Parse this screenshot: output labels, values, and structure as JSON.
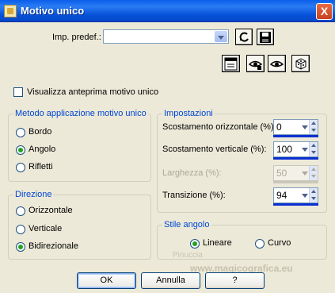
{
  "window": {
    "title": "Motivo unico",
    "close_label": "X"
  },
  "preset": {
    "label": "Imp. predef.:",
    "value": ""
  },
  "preview_checkbox": {
    "label": "Visualizza anteprima motivo unico",
    "checked": false
  },
  "method_group": {
    "title": "Metodo applicazione motivo unico",
    "options": [
      "Bordo",
      "Angolo",
      "Rifletti"
    ],
    "selected": "Angolo"
  },
  "direction_group": {
    "title": "Direzione",
    "options": [
      "Orizzontale",
      "Verticale",
      "Bidirezionale"
    ],
    "selected": "Bidirezionale"
  },
  "settings_group": {
    "title": "Impostazioni",
    "fields": [
      {
        "label": "Scostamento orizzontale (%):",
        "value": "0",
        "enabled": true
      },
      {
        "label": "Scostamento verticale (%):",
        "value": "100",
        "enabled": true
      },
      {
        "label": "Larghezza (%):",
        "value": "50",
        "enabled": false
      },
      {
        "label": "Transizione (%):",
        "value": "94",
        "enabled": true
      }
    ]
  },
  "corner_group": {
    "title": "Stile angolo",
    "options": [
      "Lineare",
      "Curvo"
    ],
    "selected": "Lineare"
  },
  "buttons": {
    "ok": "OK",
    "cancel": "Annulla",
    "help": "?"
  },
  "watermark": {
    "line1": "Pinuccia",
    "line2": "www.magicografica.eu"
  },
  "icons": [
    "app-icon",
    "reset-icon",
    "save-icon",
    "dialog-icon",
    "eye-lock-icon",
    "eye-icon",
    "random-dice-icon"
  ]
}
